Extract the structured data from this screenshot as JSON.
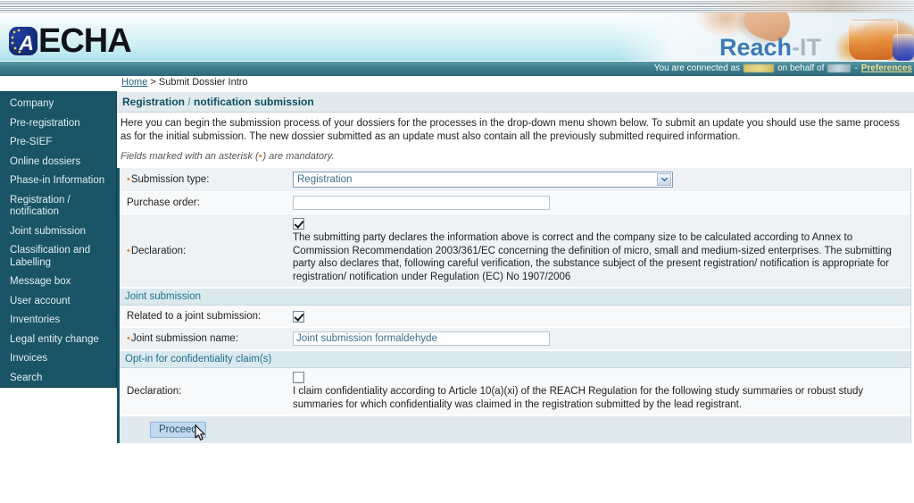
{
  "brand": {
    "logo_text": "ECHA",
    "logo_mark_letter": "A",
    "product_name_1": "Reach",
    "product_name_2": "-IT"
  },
  "statusbar": {
    "connected_prefix": "You are connected as",
    "on_behalf_of": "on behalf of",
    "separator": "-",
    "preferences_label": "Preferences"
  },
  "breadcrumb": {
    "home": "Home",
    "separator": ">",
    "current": "Submit Dossier Intro"
  },
  "sidebar": {
    "items": [
      {
        "label": "Company"
      },
      {
        "label": "Pre-registration"
      },
      {
        "label": "Pre-SIEF"
      },
      {
        "label": "Online dossiers"
      },
      {
        "label": "Phase-in Information"
      },
      {
        "label": "Registration / notification"
      },
      {
        "label": "Joint submission"
      },
      {
        "label": "Classification and Labelling"
      },
      {
        "label": "Message box"
      },
      {
        "label": "User account"
      },
      {
        "label": "Inventories"
      },
      {
        "label": "Legal entity change"
      },
      {
        "label": "Invoices"
      },
      {
        "label": "Search"
      }
    ]
  },
  "panel": {
    "title_part1": "Registration",
    "title_slash": "/",
    "title_part2": "notification submission",
    "intro": "Here you can begin the submission process of your dossiers for the processes in the drop-down menu shown below. To submit an update you should use the same process as for the initial submission. The new dossier submitted as an update must also contain all the previously submitted required information.",
    "mandatory_note_pre": "Fields marked with an asterisk (",
    "mandatory_note_ast": "•",
    "mandatory_note_post": ") are mandatory."
  },
  "form": {
    "submission_type": {
      "label": "Submission type:",
      "required": true,
      "value": "Registration",
      "options": [
        "Registration"
      ]
    },
    "purchase_order": {
      "label": "Purchase order:",
      "required": false,
      "value": "",
      "placeholder": ""
    },
    "declaration_main": {
      "label": "Declaration:",
      "required": true,
      "checked": true,
      "text": "The submitting party declares the information above is correct and the company size to be calculated according to Annex to Commission Recommendation 2003/361/EC concerning the definition of micro, small and medium-sized enterprises. The submitting party also declares that, following careful verification, the substance subject of the present registration/ notification is appropriate for registration/ notification under Regulation (EC) No 1907/2006"
    },
    "joint_submission_section": {
      "heading": "Joint submission",
      "related_label": "Related to a joint submission:",
      "related_checked": true,
      "name_label": "Joint submission name:",
      "name_required": true,
      "name_value": "Joint submission formaldehyde",
      "name_placeholder": ""
    },
    "confidentiality_section": {
      "heading": "Opt-in for confidentiality claim(s)",
      "declaration_label": "Declaration:",
      "checked": false,
      "text": "I claim confidentiality according to Article 10(a)(xi) of the REACH Regulation for the following study summaries or robust study summaries for which confidentiality was claimed in the registration submitted by the lead registrant."
    },
    "proceed_button": "Proceed"
  },
  "colors": {
    "sidebar_bg": "#1a5467",
    "accent_teal": "#2e6e7e",
    "panel_header_bg": "#e2eaee",
    "link": "#1f5f72",
    "asterisk": "#e08a22",
    "button_bg": "#c2d8ee"
  }
}
